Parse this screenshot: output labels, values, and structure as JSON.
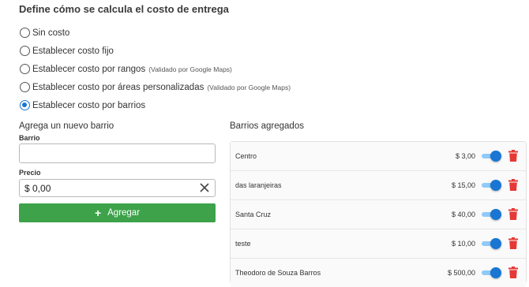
{
  "header": {
    "title": "Define cómo se calcula el costo de entrega"
  },
  "delivery_options": [
    {
      "label": "Sin costo",
      "note": "",
      "checked": false
    },
    {
      "label": "Establecer costo fijo",
      "note": "",
      "checked": false
    },
    {
      "label": "Establecer costo por rangos",
      "note": "(Validado por Google Maps)",
      "checked": false
    },
    {
      "label": "Establecer costo por áreas personalizadas",
      "note": "(Validado por Google Maps)",
      "checked": false
    },
    {
      "label": "Establecer costo por barrios",
      "note": "",
      "checked": true
    }
  ],
  "new_barrio": {
    "section_title": "Agrega un nuevo barrio",
    "barrio_label": "Barrio",
    "barrio_value": "",
    "precio_label": "Precio",
    "precio_value": "$ 0,00",
    "add_label": "Agregar"
  },
  "barrios": {
    "section_title": "Barrios agregados",
    "items": [
      {
        "name": "Centro",
        "price": "$ 3,00",
        "enabled": true
      },
      {
        "name": "das laranjeiras",
        "price": "$ 15,00",
        "enabled": true
      },
      {
        "name": "Santa Cruz",
        "price": "$ 40,00",
        "enabled": true
      },
      {
        "name": "teste",
        "price": "$ 10,00",
        "enabled": true
      },
      {
        "name": "Theodoro de Souza Barros",
        "price": "$ 500,00",
        "enabled": true
      }
    ]
  },
  "colors": {
    "accent": "#1976d2",
    "add_button": "#3da24a",
    "delete": "#e53935"
  }
}
